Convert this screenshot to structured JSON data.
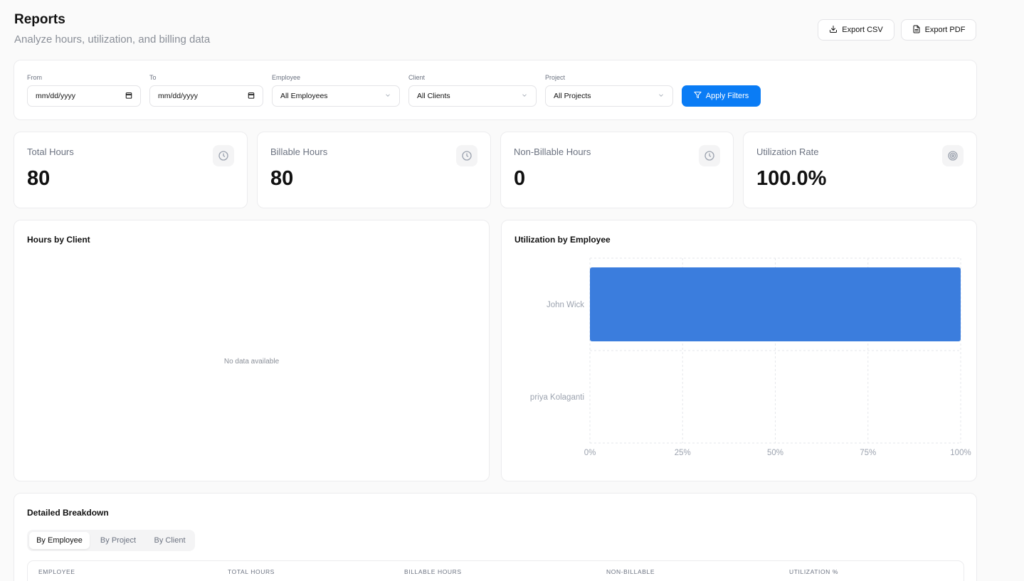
{
  "header": {
    "title": "Reports",
    "subtitle": "Analyze hours, utilization, and billing data",
    "export_csv_label": "Export CSV",
    "export_pdf_label": "Export PDF"
  },
  "filters": {
    "from": {
      "label": "From",
      "value": "mm/dd/yyyy"
    },
    "to": {
      "label": "To",
      "value": "mm/dd/yyyy"
    },
    "employee": {
      "label": "Employee",
      "value": "All Employees"
    },
    "client": {
      "label": "Client",
      "value": "All Clients"
    },
    "project": {
      "label": "Project",
      "value": "All Projects"
    },
    "apply_label": "Apply Filters"
  },
  "stats": [
    {
      "label": "Total Hours",
      "value": "80",
      "icon": "clock-icon"
    },
    {
      "label": "Billable Hours",
      "value": "80",
      "icon": "clock-icon"
    },
    {
      "label": "Non-Billable Hours",
      "value": "0",
      "icon": "clock-icon"
    },
    {
      "label": "Utilization Rate",
      "value": "100.0%",
      "icon": "target-icon"
    }
  ],
  "hours_by_client": {
    "title": "Hours by Client",
    "empty_text": "No data available"
  },
  "utilization": {
    "title": "Utilization by Employee"
  },
  "chart_data": {
    "type": "bar",
    "orientation": "horizontal",
    "title": "Utilization by Employee",
    "categories": [
      "John Wick",
      "priya Kolaganti"
    ],
    "values": [
      100,
      0
    ],
    "xlim": [
      0,
      100
    ],
    "x_ticks": [
      "0%",
      "25%",
      "50%",
      "75%",
      "100%"
    ],
    "grid": true,
    "bar_color": "#3b7ddd"
  },
  "breakdown": {
    "title": "Detailed Breakdown",
    "tabs": [
      "By Employee",
      "By Project",
      "By Client"
    ],
    "active_tab": "By Employee",
    "columns": [
      "EMPLOYEE",
      "TOTAL HOURS",
      "BILLABLE HOURS",
      "NON-BILLABLE",
      "UTILIZATION %"
    ]
  },
  "colors": {
    "primary": "#0a7cf5",
    "bar": "#3b7ddd"
  }
}
